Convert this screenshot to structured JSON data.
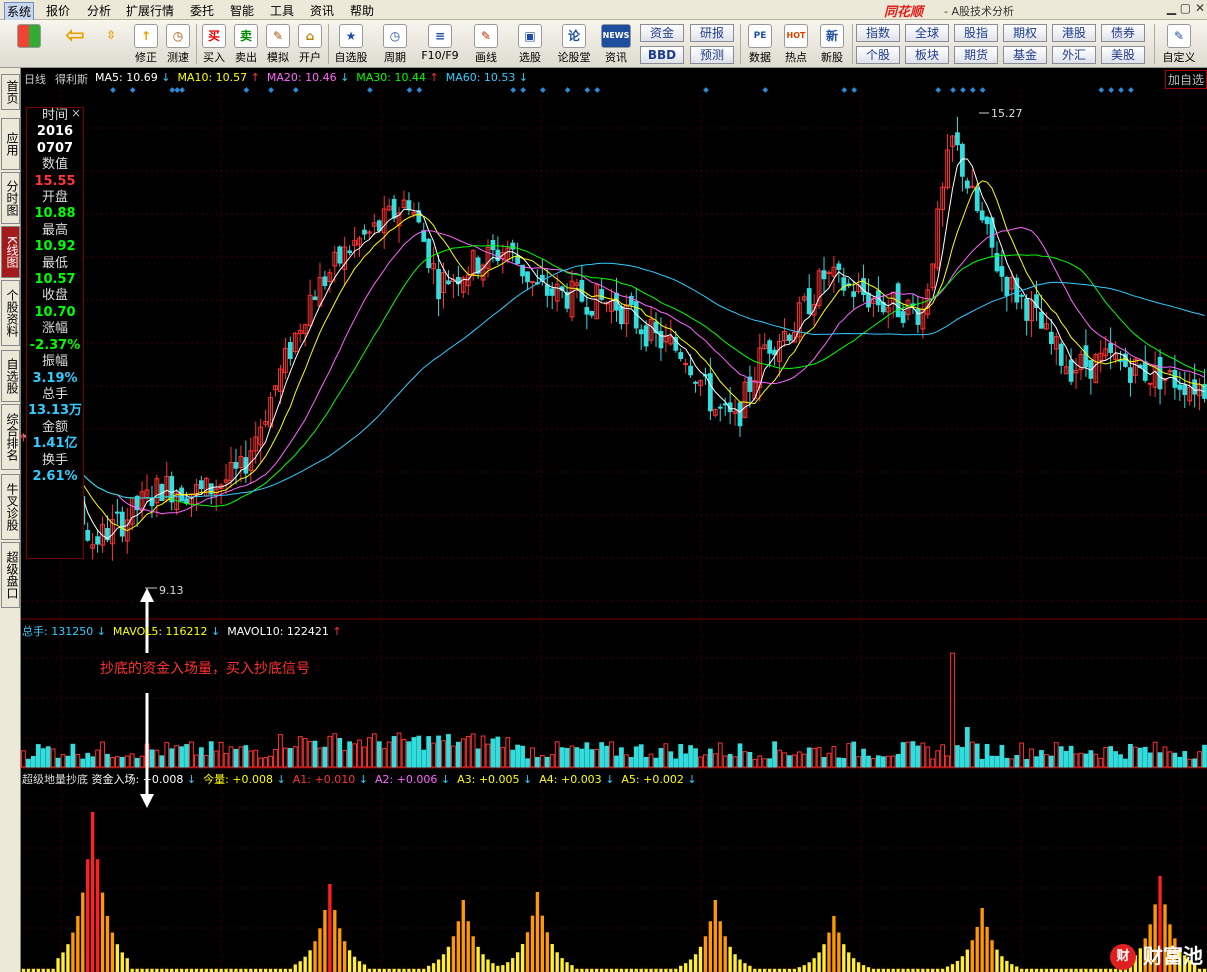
{
  "menubar": {
    "items": [
      "系统",
      "报价",
      "分析",
      "扩展行情",
      "委托",
      "智能",
      "工具",
      "资讯",
      "帮助"
    ],
    "brand": "同花顺",
    "sub": "- A股技术分析"
  },
  "toolbar": {
    "items": [
      {
        "label": "修正",
        "icon": "↑"
      },
      {
        "label": "测速",
        "icon": "◷"
      },
      {
        "label": "买入",
        "icon": "买"
      },
      {
        "label": "卖出",
        "icon": "卖"
      },
      {
        "label": "模拟",
        "icon": "✎"
      },
      {
        "label": "开户",
        "icon": "⌂"
      },
      {
        "label": "自选股",
        "icon": "★"
      },
      {
        "label": "周期",
        "icon": "◷"
      },
      {
        "label": "F10/F9",
        "icon": "≡"
      },
      {
        "label": "画线",
        "icon": "✎"
      },
      {
        "label": "选股",
        "icon": "▣"
      },
      {
        "label": "论股堂",
        "icon": "论"
      },
      {
        "label": "资讯",
        "icon": "NEWS"
      },
      {
        "label": "数据",
        "icon": "PE"
      },
      {
        "label": "热点",
        "icon": "HOT"
      },
      {
        "label": "新股",
        "icon": "新"
      },
      {
        "label": "自定义",
        "icon": "✎"
      }
    ],
    "grid_left": [
      "资金",
      "研报",
      "BBD",
      "预测"
    ],
    "grid_right": [
      "指数",
      "全球",
      "股指",
      "期权",
      "港股",
      "债券",
      "个股",
      "板块",
      "期货",
      "基金",
      "外汇",
      "美股"
    ]
  },
  "leftnav": [
    "首页",
    "应用",
    "分时图",
    "K线图",
    "个股资料",
    "自选股",
    "综合排名",
    "牛叉诊股",
    "超级盘口"
  ],
  "price_panel": {
    "period": "日线",
    "name": "得利斯",
    "ma": [
      {
        "label": "MA5: 10.69",
        "color": "#ffffff",
        "arrow": "↓"
      },
      {
        "label": "MA10: 10.57",
        "color": "#ffff00",
        "arrow": "↑"
      },
      {
        "label": "MA20: 10.46",
        "color": "#ff66ff",
        "arrow": "↓"
      },
      {
        "label": "MA30: 10.44",
        "color": "#00ff00",
        "arrow": "↑"
      },
      {
        "label": "MA60: 10.53",
        "color": "#33ccff",
        "arrow": "↓"
      }
    ],
    "high_label": "15.27",
    "low_label": "9.13",
    "add_self": "加自选"
  },
  "info": [
    {
      "k": "时间",
      "v": "2016",
      "v2": "0707",
      "c": "#ffffff"
    },
    {
      "k": "数值",
      "v": "15.55",
      "c": "#ff3333"
    },
    {
      "k": "开盘",
      "v": "10.88",
      "c": "#00ff00"
    },
    {
      "k": "最高",
      "v": "10.92",
      "c": "#00ff00"
    },
    {
      "k": "最低",
      "v": "10.57",
      "c": "#00ff00"
    },
    {
      "k": "收盘",
      "v": "10.70",
      "c": "#00ff00"
    },
    {
      "k": "涨幅",
      "v": "-2.37%",
      "c": "#00ff00"
    },
    {
      "k": "振幅",
      "v": "3.19%",
      "c": "#33ccff"
    },
    {
      "k": "总手",
      "v": "13.13万",
      "c": "#33ccff"
    },
    {
      "k": "金额",
      "v": "1.41亿",
      "c": "#33ccff"
    },
    {
      "k": "换手",
      "v": "2.61%",
      "c": "#33ccff"
    }
  ],
  "volume_panel": {
    "items": [
      {
        "label": "总手: 131250",
        "color": "#33ccff",
        "arrow": "↓"
      },
      {
        "label": "MAVOL5: 116212",
        "color": "#ffff00",
        "arrow": "↓"
      },
      {
        "label": "MAVOL10: 122421",
        "color": "#ffffff",
        "arrow": "↑"
      }
    ]
  },
  "indicator_panel": {
    "title": "超级地量抄底",
    "items": [
      {
        "label": "资金入场: +0.008",
        "color": "#ffffff",
        "arrow": "↓"
      },
      {
        "label": "今量: +0.008",
        "color": "#ffff00",
        "arrow": "↓"
      },
      {
        "label": "A1: +0.010",
        "color": "#ff3333",
        "arrow": "↓"
      },
      {
        "label": "A2: +0.006",
        "color": "#ff66ff",
        "arrow": "↓"
      },
      {
        "label": "A3: +0.005",
        "color": "#ffff00",
        "arrow": "↓"
      },
      {
        "label": "A4: +0.003",
        "color": "#ffff00",
        "arrow": "↓"
      },
      {
        "label": "A5: +0.002",
        "color": "#ffff00",
        "arrow": "↓"
      }
    ]
  },
  "annotation": "抄底的资金入场量，买入抄底信号",
  "watermark": "财富池",
  "chart_data": {
    "type": "candlestick",
    "symbol": "得利斯",
    "period": "日线",
    "price_range": [
      9.13,
      15.27
    ],
    "anchors": [
      [
        0,
        10.9
      ],
      [
        8,
        10.3
      ],
      [
        14,
        9.4
      ],
      [
        20,
        9.7
      ],
      [
        28,
        10.2
      ],
      [
        36,
        10.1
      ],
      [
        44,
        10.4
      ],
      [
        52,
        11.8
      ],
      [
        58,
        12.9
      ],
      [
        66,
        13.6
      ],
      [
        72,
        13.9
      ],
      [
        78,
        14.3
      ],
      [
        84,
        13.1
      ],
      [
        92,
        13.4
      ],
      [
        98,
        13.6
      ],
      [
        104,
        13.0
      ],
      [
        112,
        12.9
      ],
      [
        120,
        12.8
      ],
      [
        128,
        12.3
      ],
      [
        134,
        12.1
      ],
      [
        140,
        11.3
      ],
      [
        144,
        11.1
      ],
      [
        150,
        12.2
      ],
      [
        156,
        12.5
      ],
      [
        162,
        13.2
      ],
      [
        168,
        13.0
      ],
      [
        174,
        12.8
      ],
      [
        182,
        12.7
      ],
      [
        188,
        15.2
      ],
      [
        192,
        14.3
      ],
      [
        198,
        13.2
      ],
      [
        204,
        12.7
      ],
      [
        208,
        12.2
      ],
      [
        212,
        11.9
      ],
      [
        220,
        12.0
      ],
      [
        228,
        11.8
      ],
      [
        240,
        11.6
      ]
    ],
    "signal_peaks": [
      [
        14,
        1.0
      ],
      [
        62,
        0.55
      ],
      [
        89,
        0.45
      ],
      [
        104,
        0.5
      ],
      [
        140,
        0.45
      ],
      [
        164,
        0.35
      ],
      [
        194,
        0.4
      ],
      [
        230,
        0.6
      ]
    ]
  }
}
